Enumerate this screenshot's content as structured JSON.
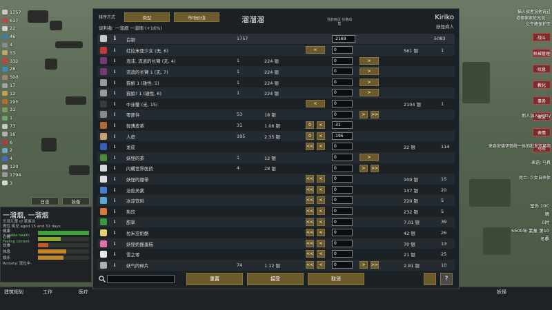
{
  "resources": [
    {
      "value": "1757",
      "color": "#c9c9c9"
    },
    {
      "value": "617",
      "color": "#b64a4a"
    },
    {
      "value": "22",
      "color": "#cfcfcf"
    },
    {
      "value": "46",
      "color": "#3e7ea6"
    },
    {
      "value": "4",
      "color": "#8a8a8a"
    },
    {
      "value": "53",
      "color": "#bfa46c"
    },
    {
      "value": "332",
      "color": "#c24242"
    },
    {
      "value": "28",
      "color": "#3b8fb3"
    },
    {
      "value": "500",
      "color": "#9c8a6a"
    },
    {
      "value": "17",
      "color": "#a0a0a0"
    },
    {
      "value": "12",
      "color": "#c4a24b"
    },
    {
      "value": "195",
      "color": "#b96b2b"
    },
    {
      "value": "31",
      "color": "#7d9d5a"
    },
    {
      "value": "1",
      "color": "#6aa26a"
    },
    {
      "value": "73",
      "color": "#c8c8c8"
    },
    {
      "value": "16",
      "color": "#b0b0b0"
    },
    {
      "value": "6",
      "color": "#b23a3a"
    },
    {
      "value": "2",
      "color": "#6fa8c9"
    },
    {
      "value": "4",
      "color": "#3f6fbf"
    },
    {
      "value": "120",
      "color": "#c9c9c9"
    },
    {
      "value": "1794",
      "color": "#9a9a9a"
    },
    {
      "value": "3",
      "color": "#d6d6d6"
    }
  ],
  "left_buttons": {
    "log": "日志",
    "gear": "装备"
  },
  "pawn": {
    "name": "一溜烟, 一溜烟",
    "sub1": "乐观儿童 of 家族派",
    "sub2": "男性 桃兄 aged 15 and 31 days",
    "needs": [
      {
        "label": "健康",
        "sub": "In stable health",
        "fill": 1.0,
        "color": "#3aa33a"
      },
      {
        "label": "心情",
        "sub": "Feeling content",
        "fill": 0.45,
        "color": "#8aa836"
      },
      {
        "label": "饮食",
        "sub": "",
        "fill": 0.2,
        "color": "#c4592a"
      },
      {
        "label": "休息",
        "sub": "",
        "fill": 0.55,
        "color": "#c4882a"
      },
      {
        "label": "娱乐",
        "sub": "",
        "fill": 0.5,
        "color": "#c4882a"
      }
    ],
    "activity": "Activity: 就位中."
  },
  "bottom_tabs": {
    "build": "建筑规划",
    "work": "工作",
    "medical": "医疗",
    "strange": "妖怪"
  },
  "dialog": {
    "sort_label": "排序方式",
    "sort_type": "类型",
    "sort_market": "市场价值",
    "title": "溜溜溜",
    "negotiator": "谈判者: 一溜烟 一溜烟 (+16%)",
    "trader_name": "Kiriko",
    "trader_kind": "妖怪商人",
    "price_header": "当前商议 价格出售",
    "silver": {
      "name": "白银",
      "colony": "1757",
      "qty": "-2169",
      "trader": "5083"
    }
  },
  "rows": [
    {
      "name": "红拉米亚少女 (无, 6)",
      "colony": "",
      "cprice": "",
      "left": "<",
      "qty": "0",
      "right": "",
      "tprice": "561 银",
      "tcount": "1",
      "iconcolor": "#c03a3a"
    },
    {
      "name": "泡沫, 流浪的长臂 (无, 4)",
      "colony": "1",
      "cprice": "224 银",
      "left": "",
      "qty": "0",
      "right": ">",
      "tprice": "",
      "tcount": "",
      "iconcolor": "#7a3a7a"
    },
    {
      "name": "流浪的长臂 1 (无, 7)",
      "colony": "1",
      "cprice": "224 银",
      "left": "",
      "qty": "0",
      "right": ">",
      "tprice": "",
      "tcount": "",
      "iconcolor": "#7a3a7a"
    },
    {
      "name": "猫娘 1 (雄性, 5)",
      "colony": "1",
      "cprice": "224 银",
      "left": "",
      "qty": "0",
      "right": ">",
      "tprice": "",
      "tcount": "",
      "iconcolor": "#999999"
    },
    {
      "name": "猫娘? 1 (雄性, 6)",
      "colony": "1",
      "cprice": "224 银",
      "left": "",
      "qty": "0",
      "right": ">",
      "tprice": "",
      "tcount": "",
      "iconcolor": "#999999"
    },
    {
      "name": "中泳蟹 (无, 15)",
      "colony": "",
      "cprice": "",
      "left": "<",
      "qty": "0",
      "right": "",
      "tprice": "2104 银",
      "tcount": "1",
      "iconcolor": "#3a3a3a"
    },
    {
      "name": "零部件",
      "colony": "53",
      "cprice": "18 银",
      "left": "",
      "qty": "0",
      "right": "> >>",
      "tprice": "",
      "tcount": "",
      "iconcolor": "#8a8a8a"
    },
    {
      "name": "轻薄皮革",
      "colony": "31",
      "cprice": "1.06 银",
      "left": "0 <",
      "qty": "-31",
      "right": "",
      "tprice": "",
      "tcount": "",
      "iconcolor": "#b5692e"
    },
    {
      "name": "人皮",
      "colony": "195",
      "cprice": "2.35 银",
      "left": "0 <",
      "qty": "-195",
      "right": "",
      "tprice": "",
      "tcount": "",
      "iconcolor": "#c8a070"
    },
    {
      "name": "龙皮",
      "colony": "",
      "cprice": "",
      "left": "<< <",
      "qty": "0",
      "right": "",
      "tprice": "22 银",
      "tcount": "114",
      "iconcolor": "#3b5fb5"
    },
    {
      "name": "妖怪的茶",
      "colony": "1",
      "cprice": "12 银",
      "left": "",
      "qty": "0",
      "right": ">",
      "tprice": "",
      "tcount": "",
      "iconcolor": "#4a8a3a"
    },
    {
      "name": "闪耀世界医药",
      "colony": "4",
      "cprice": "28 银",
      "left": "",
      "qty": "0",
      "right": "> >>",
      "tprice": "",
      "tcount": "",
      "iconcolor": "#d8d8d8"
    },
    {
      "name": "妖怪的绷带",
      "colony": "",
      "cprice": "",
      "left": "<< <",
      "qty": "0",
      "right": "",
      "tprice": "109 银",
      "tcount": "15",
      "iconcolor": "#e0e0e0"
    },
    {
      "name": "治愈灵薬",
      "colony": "",
      "cprice": "",
      "left": "<< <",
      "qty": "0",
      "right": "",
      "tprice": "137 银",
      "tcount": "20",
      "iconcolor": "#4a7fd0"
    },
    {
      "name": "冰凉饮料",
      "colony": "",
      "cprice": "",
      "left": "<< <",
      "qty": "0",
      "right": "",
      "tprice": "220 银",
      "tcount": "5",
      "iconcolor": "#5aa8d8"
    },
    {
      "name": "热饮",
      "colony": "",
      "cprice": "",
      "left": "<< <",
      "qty": "0",
      "right": "",
      "tprice": "232 银",
      "tcount": "5",
      "iconcolor": "#d8783a"
    },
    {
      "name": "甜草",
      "colony": "",
      "cprice": "",
      "left": "<< <",
      "qty": "0",
      "right": "",
      "tprice": "7.01 银",
      "tcount": "39",
      "iconcolor": "#3a9a3a"
    },
    {
      "name": "拉米亚奶酪",
      "colony": "",
      "cprice": "",
      "left": "<< <",
      "qty": "0",
      "right": "",
      "tprice": "42 银",
      "tcount": "26",
      "iconcolor": "#e8d070"
    },
    {
      "name": "妖怪奶酪蛋糕",
      "colony": "",
      "cprice": "",
      "left": "<< <",
      "qty": "0",
      "right": "",
      "tprice": "70 银",
      "tcount": "13",
      "iconcolor": "#e070b0"
    },
    {
      "name": "雪之零",
      "colony": "",
      "cprice": "",
      "left": "<< <",
      "qty": "0",
      "right": "",
      "tprice": "21 银",
      "tcount": "25",
      "iconcolor": "#e8e8e8"
    },
    {
      "name": "妖气的碎片",
      "colony": "74",
      "cprice": "1.12 银",
      "left": "<< <",
      "qty": "0",
      "right": "> >>",
      "tprice": "2.81 银",
      "tcount": "10",
      "iconcolor": "#b0b0b0"
    }
  ],
  "footer": {
    "reset": "重置",
    "accept": "接受",
    "cancel": "取消"
  },
  "right": {
    "tabs": [
      "战斗",
      "机械管理",
      "叹息",
      "教化",
      "事务",
      "聚会",
      "表情",
      "马车"
    ],
    "messages": [
      "猫人驭者说他说过",
      "道德家家伦兄说 …",
      "公牛峰保护王"
    ],
    "notices": [
      "新人加入: Kitty",
      "来自安德伊翁统一体的批发贸易商",
      "表语: 马具",
      "死亡: 少女自杀体"
    ],
    "weather": [
      "室外 10C",
      "晴",
      "0时",
      "5500年 素象 第10天",
      "冬季"
    ]
  }
}
